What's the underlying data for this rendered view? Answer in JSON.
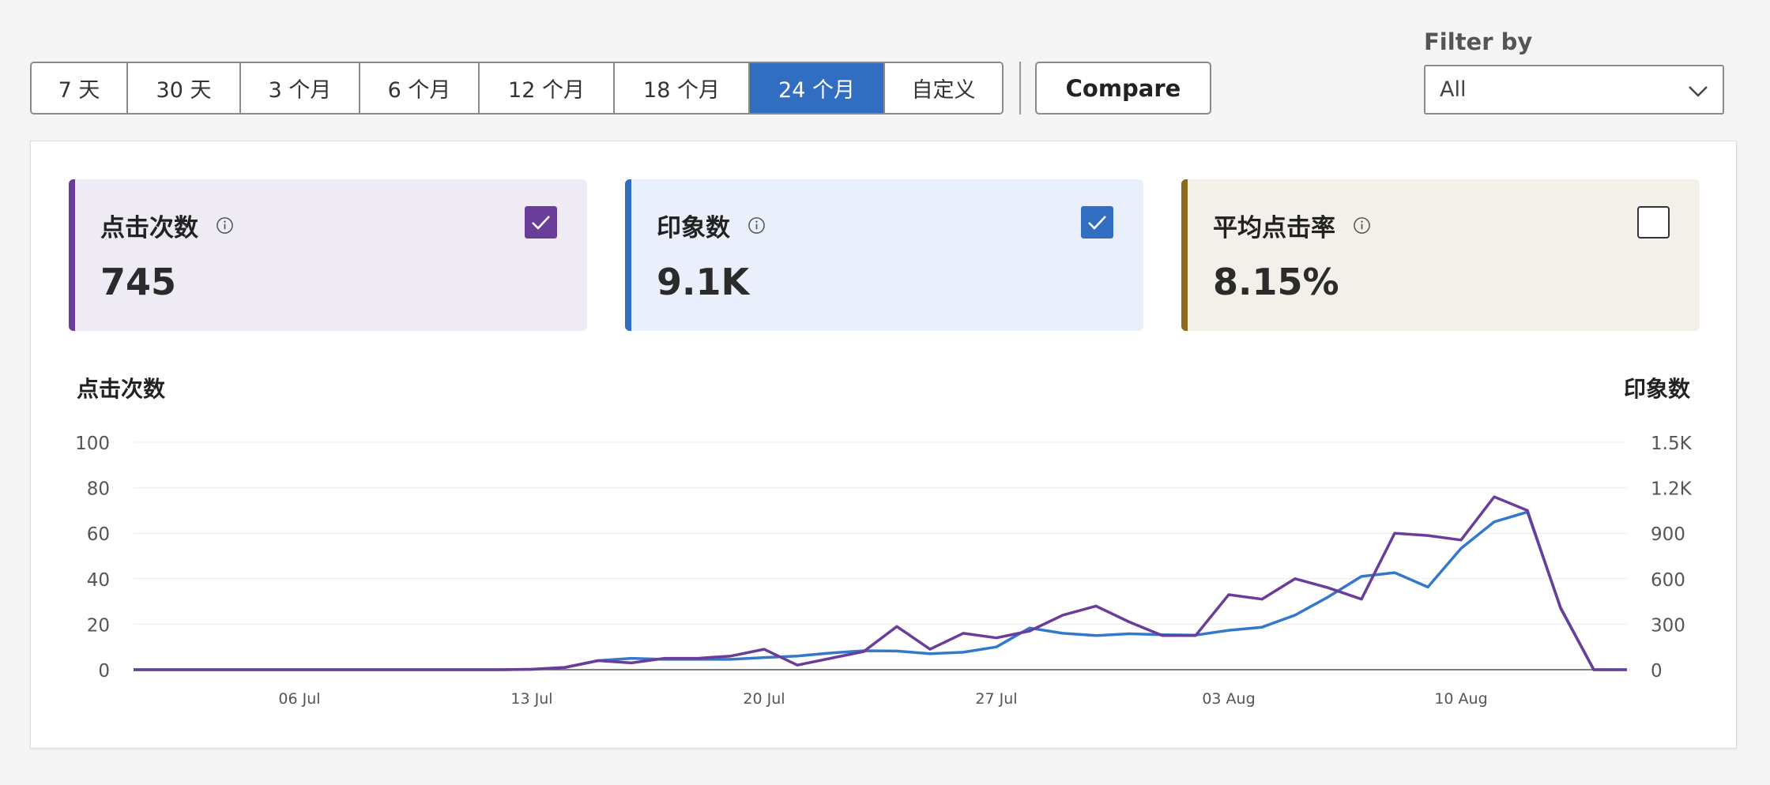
{
  "toolbar": {
    "ranges": [
      {
        "label": "7 天",
        "active": false
      },
      {
        "label": "30 天",
        "active": false
      },
      {
        "label": "3 个月",
        "active": false
      },
      {
        "label": "6 个月",
        "active": false
      },
      {
        "label": "12 个月",
        "active": false
      },
      {
        "label": "18 个月",
        "active": false
      },
      {
        "label": "24 个月",
        "active": true
      },
      {
        "label": "自定义",
        "active": false
      }
    ],
    "compare_label": "Compare"
  },
  "filter": {
    "label": "Filter by",
    "selected": "All"
  },
  "kpis": [
    {
      "title": "点击次数",
      "value": "745",
      "checked": true,
      "accent": "#6a3d9a",
      "bg": "#efebf5",
      "check_color": "#6a3d9a"
    },
    {
      "title": "印象数",
      "value": "9.1K",
      "checked": true,
      "accent": "#316ec1",
      "bg": "#e9f0fb",
      "check_color": "#316ec1"
    },
    {
      "title": "平均点击率",
      "value": "8.15%",
      "checked": false,
      "accent": "#8a6a1e",
      "bg": "#f3f0ea",
      "check_color": "#333333"
    }
  ],
  "chart_data": {
    "type": "line",
    "left_axis_title": "点击次数",
    "right_axis_title": "印象数",
    "x_tick_labels": [
      "06 Jul",
      "13 Jul",
      "20 Jul",
      "27 Jul",
      "03 Aug",
      "10 Aug"
    ],
    "y_left": {
      "min": 0,
      "max": 100,
      "ticks": [
        "0",
        "20",
        "40",
        "60",
        "80",
        "100"
      ]
    },
    "y_right": {
      "min": 0,
      "max": 1500,
      "ticks": [
        "0",
        "300",
        "600",
        "900",
        "1.2K",
        "1.5K"
      ]
    },
    "grid": true,
    "series": [
      {
        "name": "点击次数",
        "axis": "left",
        "color": "#6a3d9a",
        "values": [
          0,
          0,
          0,
          0,
          0,
          0,
          0,
          0,
          0,
          0,
          0,
          0,
          0.2,
          1,
          4,
          3,
          5,
          5,
          6,
          9,
          2,
          5,
          8,
          19,
          9,
          16,
          14,
          17,
          24,
          28,
          21,
          15,
          15,
          33,
          31,
          40,
          36,
          31,
          60,
          59,
          57,
          76,
          70,
          27,
          0,
          0
        ]
      },
      {
        "name": "印象数",
        "axis": "right",
        "color": "#3478cc",
        "values": [
          0,
          0,
          0,
          0,
          0,
          0,
          0,
          0,
          0,
          0,
          0,
          0,
          2,
          15,
          60,
          75,
          68,
          68,
          68,
          80,
          90,
          110,
          125,
          123,
          105,
          115,
          150,
          275,
          240,
          225,
          237,
          230,
          228,
          260,
          280,
          360,
          480,
          615,
          640,
          545,
          800,
          975,
          1040,
          410,
          0,
          0
        ]
      }
    ],
    "start_date": "2024-07-01"
  }
}
